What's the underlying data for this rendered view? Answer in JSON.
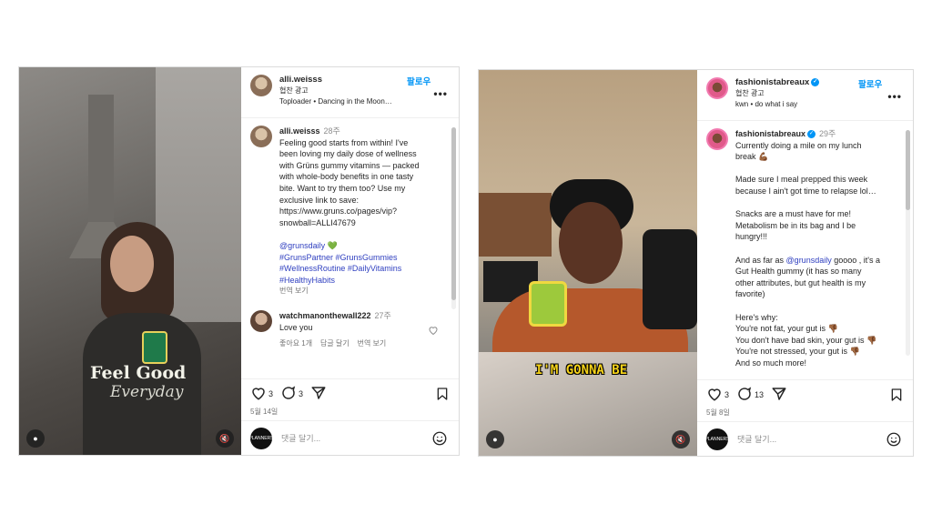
{
  "post1": {
    "username": "alli.weisss",
    "follow": "팔로우",
    "sponsored": "협찬 광고",
    "audio": "Toploader • Dancing in the Moon…",
    "caption_time": "28주",
    "caption": [
      "Feeling good starts from within! I've",
      "been loving my daily dose of wellness",
      "with Grüns gummy vitamins — packed",
      "with whole-body benefits in one tasty",
      "bite. Want to try them too? Use my",
      "exclusive link to save:",
      "https://www.gruns.co/pages/vip?",
      "snowball=ALLI47679"
    ],
    "mention": "@grunsdaily 💚",
    "hashtags": [
      "#GrunsPartner #GrunsGummies",
      "#WellnessRoutine #DailyVitamins",
      "#HealthyHabits"
    ],
    "see_translation": "번역 보기",
    "comment": {
      "username": "watchmanonthewall222",
      "time": "27주",
      "text": "Love you",
      "likes": "좋아요 1개",
      "reply": "답글 달기",
      "translate": "번역 보기"
    },
    "like_count": "3",
    "comment_count": "3",
    "date": "5월 14일",
    "add_comment": "댓글 달기...",
    "overlay_title": "Feel Good",
    "overlay_sub": "Everyday"
  },
  "post2": {
    "username": "fashionistabreaux",
    "follow": "팔로우",
    "sponsored": "협찬 광고",
    "audio": "kwn • do what i say",
    "caption_time": "29주",
    "caption_lines": [
      "Currently doing a mile on my lunch",
      "break 💪🏾",
      "",
      "Made sure I meal prepped this week",
      "because I ain't got time to relapse lol…",
      "",
      "Snacks are a must have for me!",
      "Metabolism be in its bag and I be",
      "hungry!!!",
      ""
    ],
    "and_as_far": "And as far as",
    "mention": "@grunsdaily",
    "after_mention": " goooo , it's a",
    "caption_lines2": [
      "Gut Health gummy (it has so many",
      "other attributes, but gut health is my",
      "favorite)",
      "",
      "Here's why:",
      "You're not fat, your gut is 👎🏾",
      "You don't have bad skin, your gut is 👎🏾",
      "You're not stressed, your gut is 👎🏾",
      "And so much more!"
    ],
    "like_count": "3",
    "comment_count": "13",
    "date": "5월 8일",
    "add_comment": "댓글 달기...",
    "subtitle": "I'M GONNA BE"
  },
  "brand_avatar": "PLANNERS"
}
